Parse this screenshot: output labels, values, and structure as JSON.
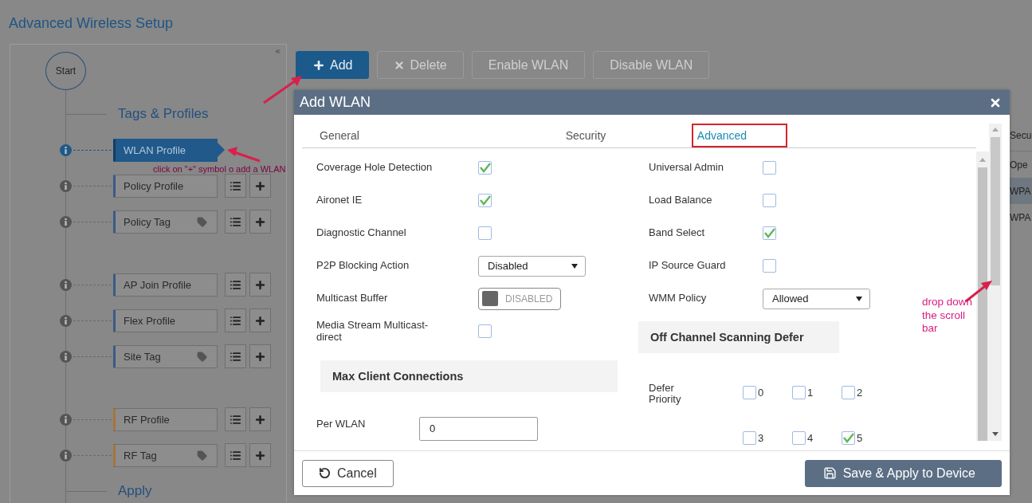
{
  "page": {
    "title": "Advanced Wireless Setup"
  },
  "toolbar": [
    {
      "label": "Add",
      "kind": "add",
      "disabled": false
    },
    {
      "label": "Delete",
      "kind": "delete",
      "disabled": true
    },
    {
      "label": "Enable WLAN",
      "kind": "plain",
      "disabled": true
    },
    {
      "label": "Disable WLAN",
      "kind": "plain",
      "disabled": true
    }
  ],
  "wizard": {
    "start": "Start",
    "sections": [
      {
        "heading": "Tags & Profiles",
        "groups": [
          {
            "items": [
              {
                "label": "WLAN Profile",
                "kind": "profile",
                "selected": true,
                "color": "#123f66"
              },
              {
                "label": "Policy Profile",
                "kind": "profile",
                "selected": false,
                "color": "#3b5b86"
              },
              {
                "label": "Policy Tag",
                "kind": "tag",
                "selected": false,
                "color": "#3b5b86"
              }
            ]
          },
          {
            "items": [
              {
                "label": "AP Join Profile",
                "kind": "profile",
                "selected": false,
                "color": "#3b5b86"
              },
              {
                "label": "Flex Profile",
                "kind": "profile",
                "selected": false,
                "color": "#3b5b86"
              },
              {
                "label": "Site Tag",
                "kind": "tag",
                "selected": false,
                "color": "#3b5b86"
              }
            ]
          },
          {
            "items": [
              {
                "label": "RF Profile",
                "kind": "profile",
                "selected": false,
                "color": "#a8743a"
              },
              {
                "label": "RF Tag",
                "kind": "tag",
                "selected": false,
                "color": "#a8743a"
              }
            ]
          }
        ]
      },
      {
        "heading": "Apply"
      }
    ]
  },
  "background_table": {
    "header": "Secu",
    "rows": [
      {
        "text": "Ope",
        "selected": false
      },
      {
        "text": "WPA",
        "selected": true
      },
      {
        "text": "WPA",
        "selected": false
      }
    ]
  },
  "modal": {
    "title": "Add WLAN",
    "tabs": [
      {
        "label": "General",
        "selected": false
      },
      {
        "label": "Security",
        "selected": false
      },
      {
        "label": "Advanced",
        "selected": true
      }
    ],
    "left": [
      {
        "kind": "checkbox",
        "label": "Coverage Hole Detection",
        "checked": true
      },
      {
        "kind": "checkbox",
        "label": "Aironet IE",
        "checked": true
      },
      {
        "kind": "checkbox",
        "label": "Diagnostic Channel",
        "checked": false
      },
      {
        "kind": "select",
        "label": "P2P Blocking Action",
        "value": "Disabled"
      },
      {
        "kind": "toggle",
        "label": "Multicast Buffer",
        "text": "DISABLED",
        "on": false
      },
      {
        "kind": "checkbox",
        "label": "Media Stream Multicast-direct",
        "checked": false
      },
      {
        "kind": "section",
        "label": "Max Client Connections"
      },
      {
        "kind": "input",
        "label": "Per WLAN",
        "value": "0"
      }
    ],
    "right": [
      {
        "kind": "checkbox",
        "label": "Universal Admin",
        "checked": false
      },
      {
        "kind": "checkbox",
        "label": "Load Balance",
        "checked": false
      },
      {
        "kind": "checkbox",
        "label": "Band Select",
        "checked": true
      },
      {
        "kind": "checkbox",
        "label": "IP Source Guard",
        "checked": false
      },
      {
        "kind": "select",
        "label": "WMM Policy",
        "value": "Allowed"
      },
      {
        "kind": "section",
        "label": "Off Channel Scanning Defer"
      },
      {
        "kind": "priority",
        "label": "Defer Priority",
        "options": [
          {
            "label": "0",
            "checked": false
          },
          {
            "label": "1",
            "checked": false
          },
          {
            "label": "2",
            "checked": false
          },
          {
            "label": "3",
            "checked": false
          },
          {
            "label": "4",
            "checked": false
          },
          {
            "label": "5",
            "checked": true
          }
        ]
      }
    ],
    "buttons": [
      {
        "label": "Cancel",
        "kind": "cancel"
      },
      {
        "label": "Save & Apply to Device",
        "kind": "save"
      }
    ]
  },
  "annotations": [
    {
      "kind": "tree",
      "text": "click on \"+\" symbol o add a WLAN"
    },
    {
      "kind": "scroll",
      "text": "drop down the scroll bar"
    }
  ]
}
